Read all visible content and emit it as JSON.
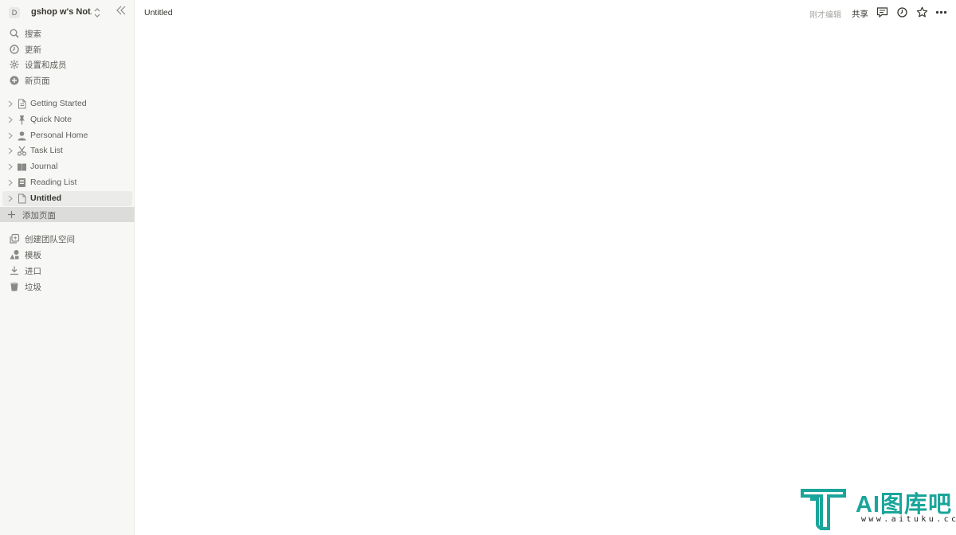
{
  "workspace": {
    "avatar_letter": "D",
    "name": "gshop w's Not..."
  },
  "sidebar": {
    "nav": [
      {
        "label": "搜索",
        "icon": "search-icon"
      },
      {
        "label": "更新",
        "icon": "clock-icon"
      },
      {
        "label": "设置和成员",
        "icon": "gear-icon"
      },
      {
        "label": "新页面",
        "icon": "plus-circle-icon"
      }
    ],
    "pages": [
      {
        "label": "Getting Started",
        "icon": "document-icon"
      },
      {
        "label": "Quick Note",
        "icon": "pin-icon"
      },
      {
        "label": "Personal Home",
        "icon": "person-icon"
      },
      {
        "label": "Task List",
        "icon": "scissors-icon"
      },
      {
        "label": "Journal",
        "icon": "book-icon"
      },
      {
        "label": "Reading List",
        "icon": "notebook-icon"
      },
      {
        "label": "Untitled",
        "icon": "document-icon",
        "active": true
      }
    ],
    "add_page_label": "添加页面",
    "bottom": [
      {
        "label": "创建团队空间",
        "icon": "teamspace-icon"
      },
      {
        "label": "模板",
        "icon": "shapes-icon"
      },
      {
        "label": "进口",
        "icon": "download-icon"
      },
      {
        "label": "垃圾",
        "icon": "trash-icon"
      }
    ]
  },
  "topbar": {
    "page_title": "Untitled",
    "edited_status": "刚才编辑",
    "share_label": "共享"
  },
  "watermark": {
    "text": "AI图库吧",
    "sub": "www.aituku.cc"
  },
  "colors": {
    "sidebar_bg": "#f7f7f5",
    "active_bg": "#ebebea",
    "watermark": "#1aa59a"
  }
}
